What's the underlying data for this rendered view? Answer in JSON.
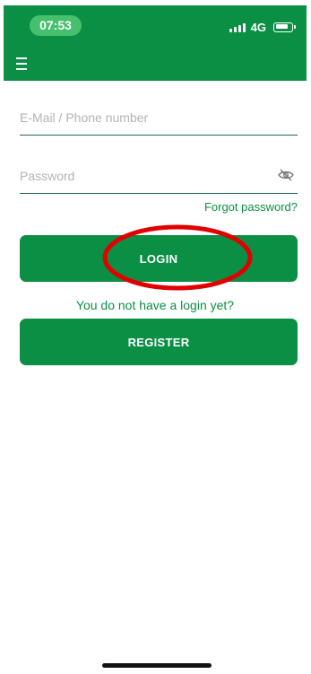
{
  "status_bar": {
    "time": "07:53",
    "network": "4G",
    "signal_icon": "signal-bars-icon",
    "battery_icon": "battery-icon"
  },
  "app_bar": {
    "menu_icon": "hamburger-menu-icon"
  },
  "login_form": {
    "email_placeholder": "E-Mail / Phone number",
    "email_value": "",
    "password_placeholder": "Password",
    "password_value": "",
    "password_visibility_icon": "eye-off-icon",
    "forgot_password_label": "Forgot password?",
    "login_button_label": "LOGIN",
    "no_login_text": "You do not have a login yet?",
    "register_button_label": "REGISTER"
  },
  "annotation": {
    "shape": "ellipse",
    "color": "#e10000",
    "target": "login-button"
  },
  "colors": {
    "brand_green": "#0a8f44",
    "time_pill": "#46c06c",
    "field_underline": "#1b6a55"
  }
}
